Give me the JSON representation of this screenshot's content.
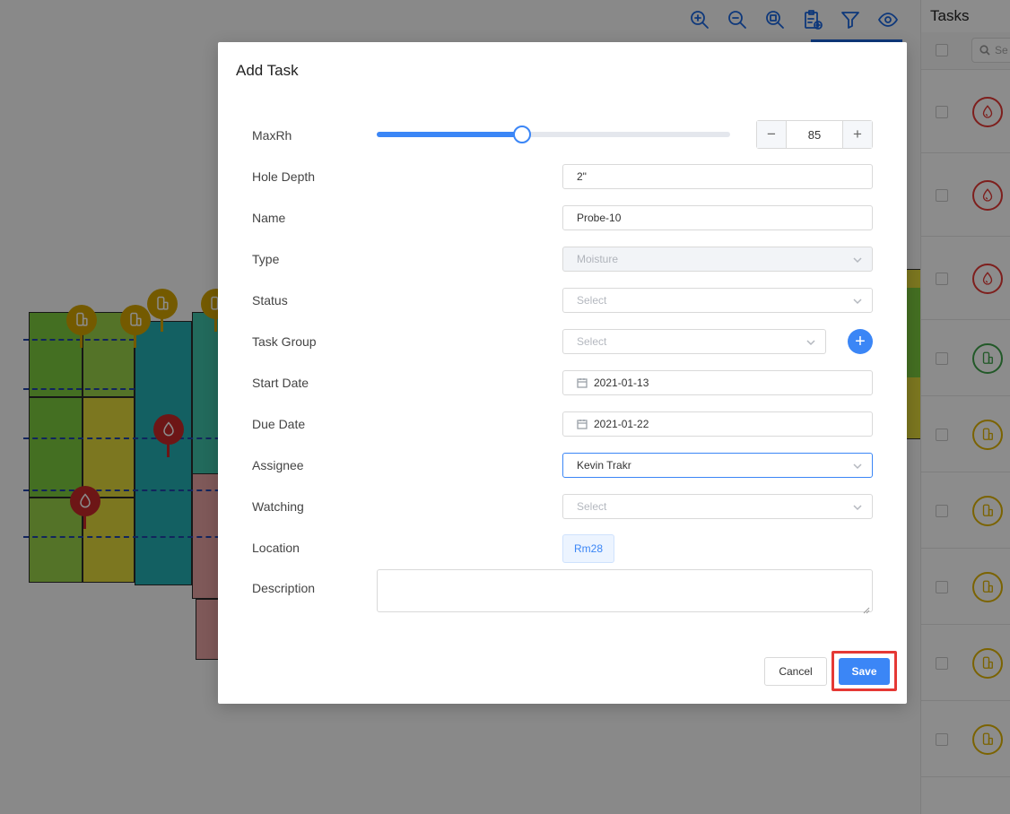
{
  "colors": {
    "accent": "#3b86f6",
    "highlight": "#e53935",
    "task_red": "#e53935",
    "task_green": "#3ea24a",
    "task_yellow": "#e0b400"
  },
  "toolbar": {
    "icons": [
      "zoom-in-icon",
      "zoom-out-icon",
      "zoom-fit-icon",
      "clipboard-add-icon",
      "filter-icon",
      "eye-icon"
    ]
  },
  "tasks_panel": {
    "title": "Tasks",
    "search_placeholder": "Se",
    "rows": [
      {
        "icon": "moisture-icon",
        "color": "red"
      },
      {
        "icon": "moisture-icon",
        "color": "red"
      },
      {
        "icon": "moisture-icon",
        "color": "red"
      },
      {
        "icon": "probe-icon",
        "color": "green"
      },
      {
        "icon": "probe-icon",
        "color": "yellow"
      },
      {
        "icon": "probe-icon",
        "color": "yellow"
      },
      {
        "icon": "probe-icon",
        "color": "yellow"
      },
      {
        "icon": "probe-icon",
        "color": "yellow"
      },
      {
        "icon": "probe-icon",
        "color": "yellow"
      }
    ]
  },
  "modal": {
    "title": "Add Task",
    "maxrh": {
      "label": "MaxRh",
      "value": "85",
      "slider_fraction": 0.41,
      "minus": "−",
      "plus": "+"
    },
    "hole_depth": {
      "label": "Hole Depth",
      "value": "2\""
    },
    "name": {
      "label": "Name",
      "value": "Probe-10"
    },
    "type": {
      "label": "Type",
      "value": "Moisture"
    },
    "status": {
      "label": "Status",
      "placeholder": "Select"
    },
    "task_group": {
      "label": "Task Group",
      "placeholder": "Select",
      "add": "+"
    },
    "start_date": {
      "label": "Start Date",
      "value": "2021-01-13"
    },
    "due_date": {
      "label": "Due Date",
      "value": "2021-01-22"
    },
    "assignee": {
      "label": "Assignee",
      "value": "Kevin Trakr"
    },
    "watching": {
      "label": "Watching",
      "placeholder": "Select"
    },
    "location": {
      "label": "Location",
      "value": "Rm28"
    },
    "description": {
      "label": "Description",
      "value": ""
    },
    "cancel": "Cancel",
    "save": "Save"
  }
}
